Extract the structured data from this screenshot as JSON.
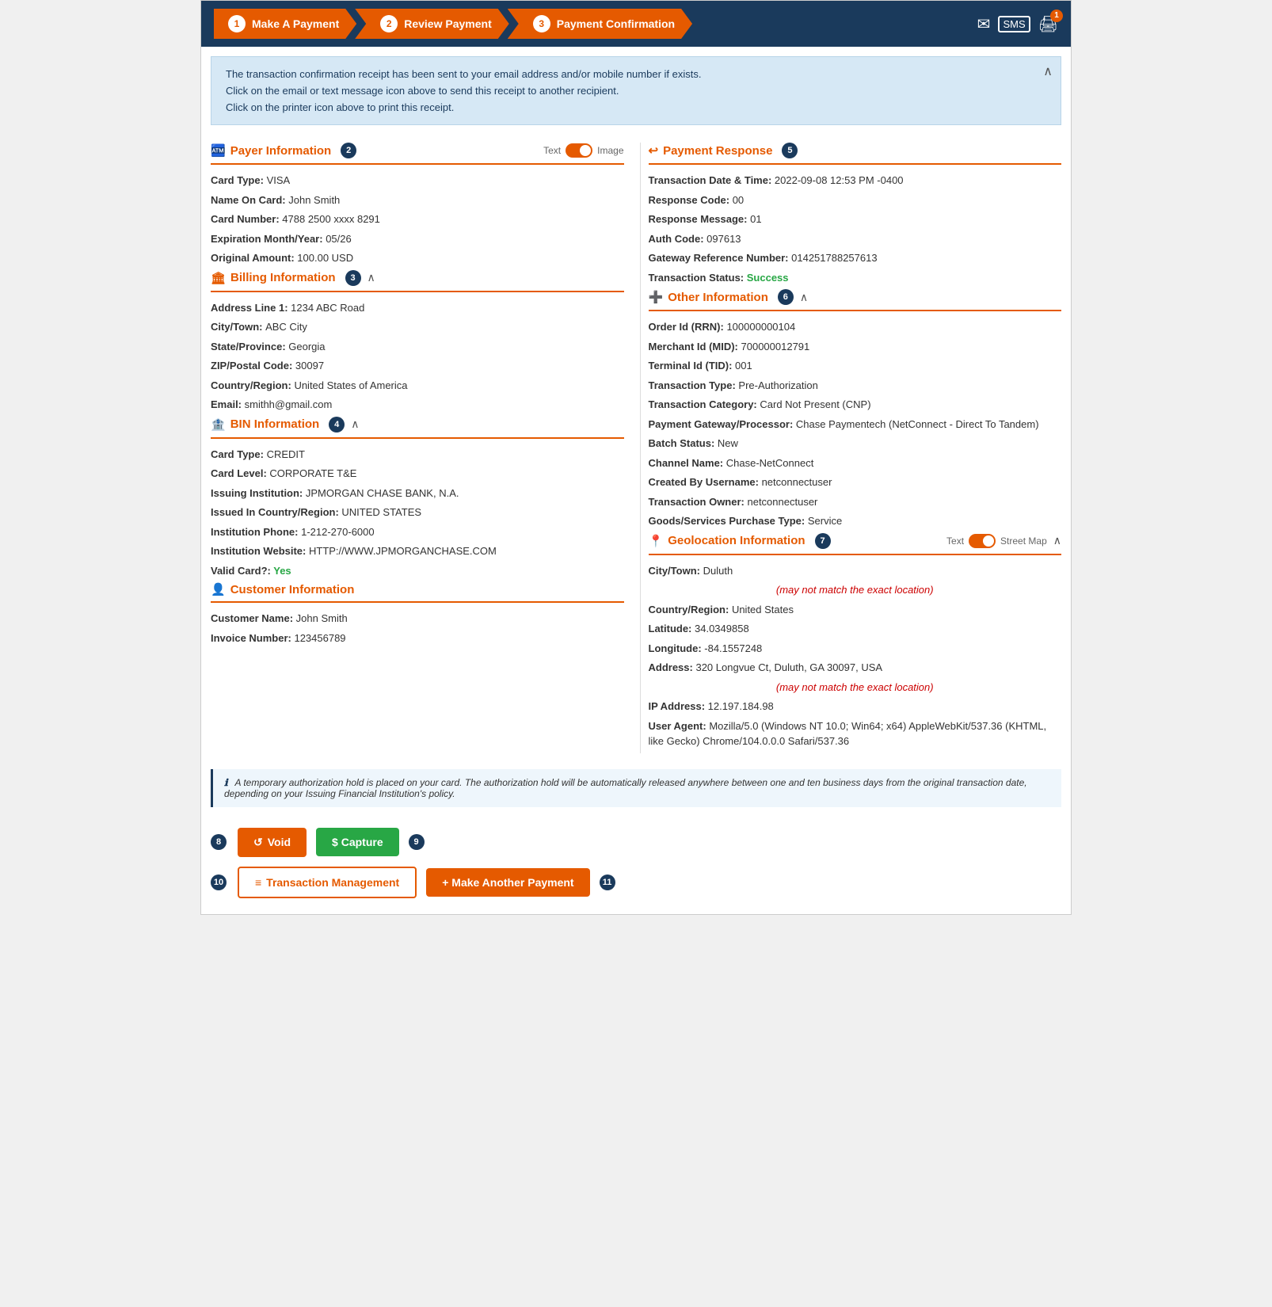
{
  "steps": [
    {
      "num": "1",
      "label": "Make A Payment"
    },
    {
      "num": "2",
      "label": "Review Payment"
    },
    {
      "num": "3",
      "label": "Payment Confirmation"
    }
  ],
  "header_icons": {
    "email": "✉",
    "sms": "SMS",
    "print": "🖨",
    "badge": "1"
  },
  "banner": {
    "line1": "The transaction confirmation receipt has been sent to your email address and/or mobile number if exists.",
    "line2": "Click on the email or text message icon above to send this receipt to another recipient.",
    "line3": "Click on the printer icon above to print this receipt."
  },
  "payer_info": {
    "title": "Payer Information",
    "num": "2",
    "toggle_left": "Text",
    "toggle_right": "Image",
    "fields": [
      {
        "label": "Card Type:",
        "value": "VISA"
      },
      {
        "label": "Name On Card:",
        "value": "John Smith"
      },
      {
        "label": "Card Number:",
        "value": "4788 2500 xxxx 8291"
      },
      {
        "label": "Expiration Month/Year:",
        "value": "05/26"
      },
      {
        "label": "Original Amount:",
        "value": "100.00 USD"
      }
    ]
  },
  "billing_info": {
    "title": "Billing Information",
    "num": "3",
    "fields": [
      {
        "label": "Address Line 1:",
        "value": "1234 ABC Road"
      },
      {
        "label": "City/Town:",
        "value": "ABC City"
      },
      {
        "label": "State/Province:",
        "value": "Georgia"
      },
      {
        "label": "ZIP/Postal Code:",
        "value": "30097"
      },
      {
        "label": "Country/Region:",
        "value": "United States of America"
      },
      {
        "label": "Email:",
        "value": "smithh@gmail.com"
      }
    ]
  },
  "bin_info": {
    "title": "BIN Information",
    "num": "4",
    "fields": [
      {
        "label": "Card Type:",
        "value": "CREDIT"
      },
      {
        "label": "Card Level:",
        "value": "CORPORATE T&E"
      },
      {
        "label": "Issuing Institution:",
        "value": "JPMORGAN CHASE BANK, N.A."
      },
      {
        "label": "Issued In Country/Region:",
        "value": "UNITED STATES"
      },
      {
        "label": "Institution Phone:",
        "value": "1-212-270-6000"
      },
      {
        "label": "Institution Website:",
        "value": "HTTP://WWW.JPMORGANCHASE.COM"
      },
      {
        "label": "Valid Card?:",
        "value": "Yes",
        "type": "success"
      }
    ]
  },
  "customer_info": {
    "title": "Customer Information",
    "fields": [
      {
        "label": "Customer Name:",
        "value": "John Smith"
      },
      {
        "label": "Invoice Number:",
        "value": "123456789"
      }
    ]
  },
  "payment_response": {
    "title": "Payment Response",
    "num": "5",
    "fields": [
      {
        "label": "Transaction Date & Time:",
        "value": "2022-09-08 12:53 PM -0400"
      },
      {
        "label": "Response Code:",
        "value": "00"
      },
      {
        "label": "Response Message:",
        "value": "01"
      },
      {
        "label": "Auth Code:",
        "value": "097613"
      },
      {
        "label": "Gateway Reference Number:",
        "value": "014251788257613"
      },
      {
        "label": "Transaction Status:",
        "value": "Success",
        "type": "success"
      }
    ]
  },
  "other_info": {
    "title": "Other Information",
    "num": "6",
    "fields": [
      {
        "label": "Order Id (RRN):",
        "value": "100000000104"
      },
      {
        "label": "Merchant Id (MID):",
        "value": "700000012791"
      },
      {
        "label": "Terminal Id (TID):",
        "value": "001"
      },
      {
        "label": "Transaction Type:",
        "value": "Pre-Authorization"
      },
      {
        "label": "Transaction Category:",
        "value": "Card Not Present (CNP)"
      },
      {
        "label": "Payment Gateway/Processor:",
        "value": "Chase Paymentech (NetConnect - Direct To Tandem)"
      },
      {
        "label": "Batch Status:",
        "value": "New"
      },
      {
        "label": "Channel Name:",
        "value": "Chase-NetConnect"
      },
      {
        "label": "Created By Username:",
        "value": "netconnectuser"
      },
      {
        "label": "Transaction Owner:",
        "value": "netconnectuser"
      },
      {
        "label": "Goods/Services Purchase Type:",
        "value": "Service"
      }
    ]
  },
  "geo_info": {
    "title": "Geolocation Information",
    "num": "7",
    "toggle_left": "Text",
    "toggle_right": "Street Map",
    "fields": [
      {
        "label": "City/Town:",
        "value": "Duluth"
      },
      {
        "label": "",
        "value": "(may not match the exact location)",
        "type": "red-note"
      },
      {
        "label": "Country/Region:",
        "value": "United States"
      },
      {
        "label": "Latitude:",
        "value": "34.0349858"
      },
      {
        "label": "Longitude:",
        "value": "-84.1557248"
      },
      {
        "label": "Address:",
        "value": "320 Longvue Ct, Duluth, GA 30097, USA"
      },
      {
        "label": "",
        "value": "(may not match the exact location)",
        "type": "red-note"
      },
      {
        "label": "IP Address:",
        "value": "12.197.184.98"
      },
      {
        "label": "User Agent:",
        "value": "Mozilla/5.0 (Windows NT 10.0; Win64; x64) AppleWebKit/537.36 (KHTML, like Gecko) Chrome/104.0.0.0 Safari/537.36"
      }
    ]
  },
  "info_note": "A temporary authorization hold is placed on your card. The authorization hold will be automatically released anywhere between one and ten business days from the original transaction date, depending on your Issuing Financial Institution's policy.",
  "buttons": {
    "void_label": "Void",
    "capture_label": "$ Capture",
    "transaction_label": "Transaction Management",
    "make_payment_label": "+ Make Another Payment",
    "void_num": "8",
    "capture_num": "9",
    "transaction_num": "10",
    "make_payment_num": "11"
  }
}
